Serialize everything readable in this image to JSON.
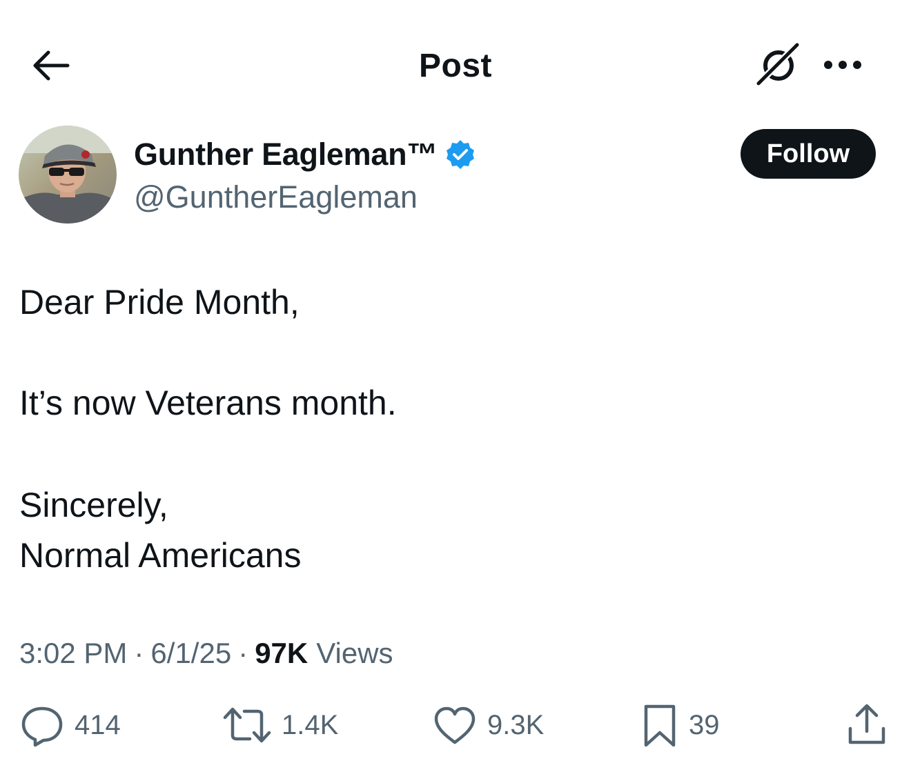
{
  "header": {
    "title": "Post",
    "back_icon": "arrow-left-icon",
    "grok_icon": "grok-icon",
    "more_icon": "more-horizontal-icon"
  },
  "author": {
    "display_name": "Gunther Eagleman™",
    "handle": "@GuntherEagleman",
    "verified": true,
    "verified_color": "#1d9bf0",
    "follow_label": "Follow"
  },
  "post": {
    "lines": [
      "Dear Pride Month,",
      "It’s now Veterans month.",
      "Sincerely,",
      "Normal Americans"
    ]
  },
  "meta": {
    "time": "3:02 PM",
    "date": "6/1/25",
    "separator": "·",
    "views_count": "97K",
    "views_label": "Views"
  },
  "actions": {
    "replies": "414",
    "reposts": "1.4K",
    "likes": "9.3K",
    "bookmarks": "39"
  },
  "colors": {
    "text_primary": "#0f1419",
    "text_secondary": "#536471",
    "follow_bg": "#0f1419",
    "follow_text": "#ffffff"
  }
}
